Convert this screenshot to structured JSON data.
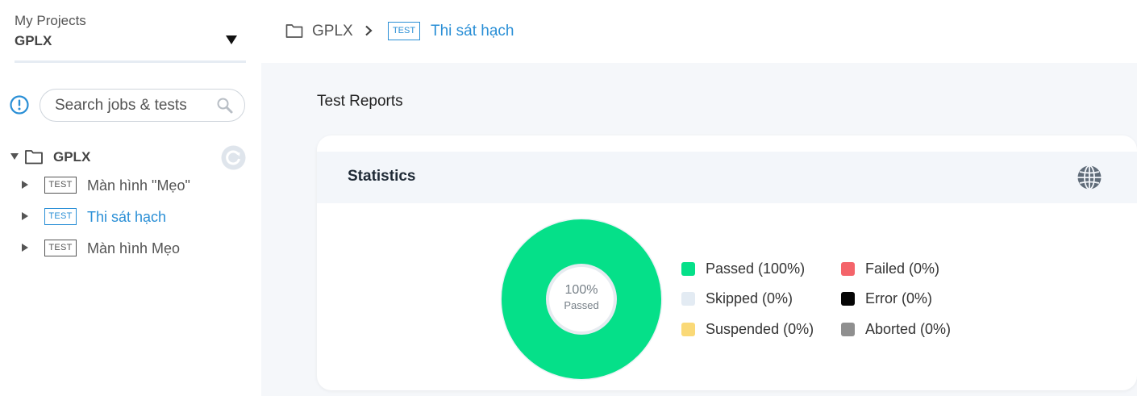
{
  "sidebar": {
    "project_label": "My Projects",
    "project_name": "GPLX",
    "search_placeholder": "Search jobs & tests",
    "tree": {
      "root_label": "GPLX",
      "items": [
        {
          "tag": "TEST",
          "label": "Màn hình \"Mẹo\""
        },
        {
          "tag": "TEST",
          "label": "Thi sát hạch"
        },
        {
          "tag": "TEST",
          "label": "Màn hình Mẹo"
        }
      ]
    }
  },
  "breadcrumb": {
    "root": "GPLX",
    "tag": "TEST",
    "current": "Thi sát hạch"
  },
  "main": {
    "title": "Test Reports",
    "card_title": "Statistics",
    "donut_percent": "100%",
    "donut_label": "Passed",
    "legend": [
      {
        "label": "Passed (100%)",
        "color": "#05e089"
      },
      {
        "label": "Skipped (0%)",
        "color": "#e3ebf3"
      },
      {
        "label": "Suspended (0%)",
        "color": "#fad977"
      },
      {
        "label": "Failed (0%)",
        "color": "#f4646a"
      },
      {
        "label": "Error (0%)",
        "color": "#050505"
      },
      {
        "label": "Aborted (0%)",
        "color": "#8f8f8f"
      }
    ]
  },
  "colors": {
    "accent": "#2a8fd6",
    "passed": "#05e089"
  }
}
